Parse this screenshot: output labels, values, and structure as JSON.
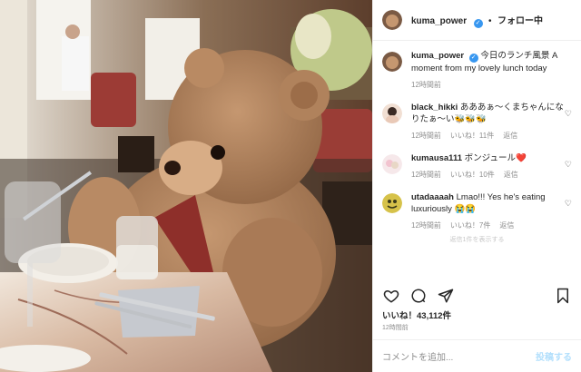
{
  "post": {
    "username": "kuma_power",
    "follow_label": "フォロー中",
    "caption_text": "今日のランチ風景 A moment from my lovely lunch today",
    "caption_time": "12時間前"
  },
  "comments": [
    {
      "username": "black_hikki",
      "text": "あああぁ〜くまちゃんになりたぁ〜い🐝🐝🐝",
      "time": "12時間前",
      "likes": "いいね！11件",
      "reply": "返信"
    },
    {
      "username": "kumausa111",
      "text": "ボンジュール❤️",
      "time": "12時間前",
      "likes": "いいね！10件",
      "reply": "返信"
    },
    {
      "username": "utadaaaah",
      "text": "Lmao!!! Yes he's eating luxuriously 😭😭",
      "time": "12時間前",
      "likes": "いいね！7件",
      "reply": "返信"
    }
  ],
  "more_hint": "返信1件を表示する",
  "likes_count": "いいね！43,112件",
  "post_time": "12時間前",
  "add_comment": {
    "placeholder": "コメントを追加...",
    "post_label": "投稿する"
  },
  "colors": {
    "accent": "#3897f0",
    "post_disabled": "#b2dffc",
    "muted": "#8e8e8e"
  },
  "icons": [
    "heart-icon",
    "comment-icon",
    "share-icon",
    "bookmark-icon",
    "verified-badge-icon",
    "comment-heart-icon"
  ]
}
